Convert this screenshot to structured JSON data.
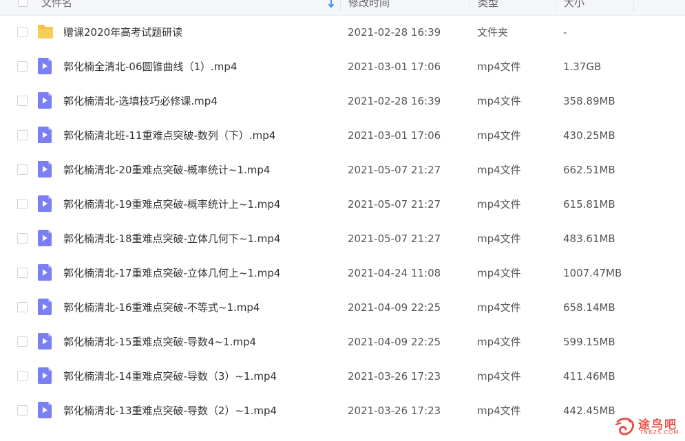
{
  "header": {
    "name_label": "文件名",
    "time_label": "修改时间",
    "type_label": "类型",
    "size_label": "大小"
  },
  "files": [
    {
      "name": "赠课2020年高考试题研读",
      "time": "2021-02-28 16:39",
      "type": "文件夹",
      "size": "-",
      "icon": "folder-icon"
    },
    {
      "name": "郭化楠全清北-06圆锥曲线（1）.mp4",
      "time": "2021-03-01 17:06",
      "type": "mp4文件",
      "size": "1.37GB",
      "icon": "video-file-icon"
    },
    {
      "name": "郭化楠清北-选填技巧必修课.mp4",
      "time": "2021-02-28 16:39",
      "type": "mp4文件",
      "size": "358.89MB",
      "icon": "video-file-icon"
    },
    {
      "name": "郭化楠清北班-11重难点突破-数列（下）.mp4",
      "time": "2021-03-01 17:06",
      "type": "mp4文件",
      "size": "430.25MB",
      "icon": "video-file-icon"
    },
    {
      "name": "郭化楠清北-20重难点突破-概率统计~1.mp4",
      "time": "2021-05-07 21:27",
      "type": "mp4文件",
      "size": "662.51MB",
      "icon": "video-file-icon"
    },
    {
      "name": "郭化楠清北-19重难点突破-概率统计上~1.mp4",
      "time": "2021-05-07 21:27",
      "type": "mp4文件",
      "size": "615.81MB",
      "icon": "video-file-icon"
    },
    {
      "name": "郭化楠清北-18重难点突破-立体几何下~1.mp4",
      "time": "2021-05-07 21:27",
      "type": "mp4文件",
      "size": "483.61MB",
      "icon": "video-file-icon"
    },
    {
      "name": "郭化楠清北-17重难点突破-立体几何上~1.mp4",
      "time": "2021-04-24 11:08",
      "type": "mp4文件",
      "size": "1007.47MB",
      "icon": "video-file-icon"
    },
    {
      "name": "郭化楠清北-16重难点突破-不等式~1.mp4",
      "time": "2021-04-09 22:25",
      "type": "mp4文件",
      "size": "658.14MB",
      "icon": "video-file-icon"
    },
    {
      "name": "郭化楠清北-15重难点突破-导数4~1.mp4",
      "time": "2021-04-09 22:25",
      "type": "mp4文件",
      "size": "599.15MB",
      "icon": "video-file-icon"
    },
    {
      "name": "郭化楠清北-14重难点突破-导数（3）~1.mp4",
      "time": "2021-03-26 17:23",
      "type": "mp4文件",
      "size": "411.46MB",
      "icon": "video-file-icon"
    },
    {
      "name": "郭化楠清北-13重难点突破-导数（2）~1.mp4",
      "time": "2021-03-26 17:23",
      "type": "mp4文件",
      "size": "442.45MB",
      "icon": "video-file-icon"
    }
  ],
  "watermark": {
    "text": "途鸟吧",
    "url_text": "TNBZS.COM"
  },
  "colors": {
    "folder": "#f7c244",
    "video": "#7b7ff5",
    "header_bg": "#f5f6fa",
    "sort_arrow": "#2f8cf5",
    "watermark": "#e8524a"
  }
}
